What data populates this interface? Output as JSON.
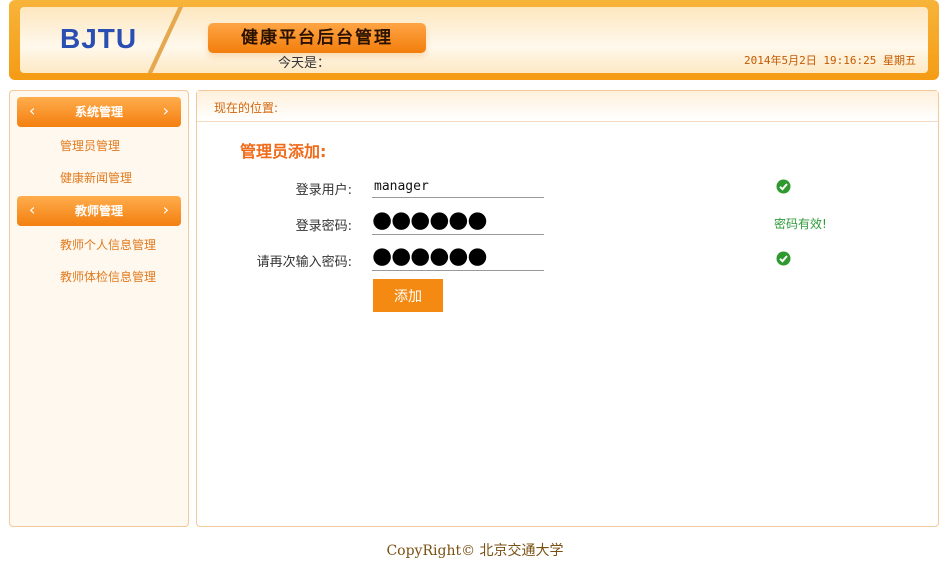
{
  "header": {
    "logo": "BJTU",
    "title": "健康平台后台管理",
    "date_label": "今天是：",
    "date_value": "2014年5月2日 19:16:25 星期五"
  },
  "sidebar": {
    "sections": [
      {
        "label": "系统管理",
        "items": [
          "管理员管理",
          "健康新闻管理"
        ]
      },
      {
        "label": "教师管理",
        "items": [
          "教师个人信息管理",
          "教师体检信息管理"
        ]
      }
    ],
    "arrow_left": "‹",
    "arrow_right": "›"
  },
  "main": {
    "breadcrumb": "现在的位置:",
    "form_title": "管理员添加:",
    "fields": {
      "username": {
        "label": "登录用户:",
        "value": "manager"
      },
      "password": {
        "label": "登录密码:",
        "masked": "●●●●●●",
        "status": "密码有效!"
      },
      "confirm": {
        "label": "请再次输入密码:",
        "masked": "●●●●●●"
      }
    },
    "submit_label": "添加"
  },
  "footer": {
    "text": "CopyRight© 北京交通大学"
  },
  "colors": {
    "accent": "#f58a12",
    "valid": "#2f9a3a",
    "brand_text": "#2a4fb3"
  }
}
